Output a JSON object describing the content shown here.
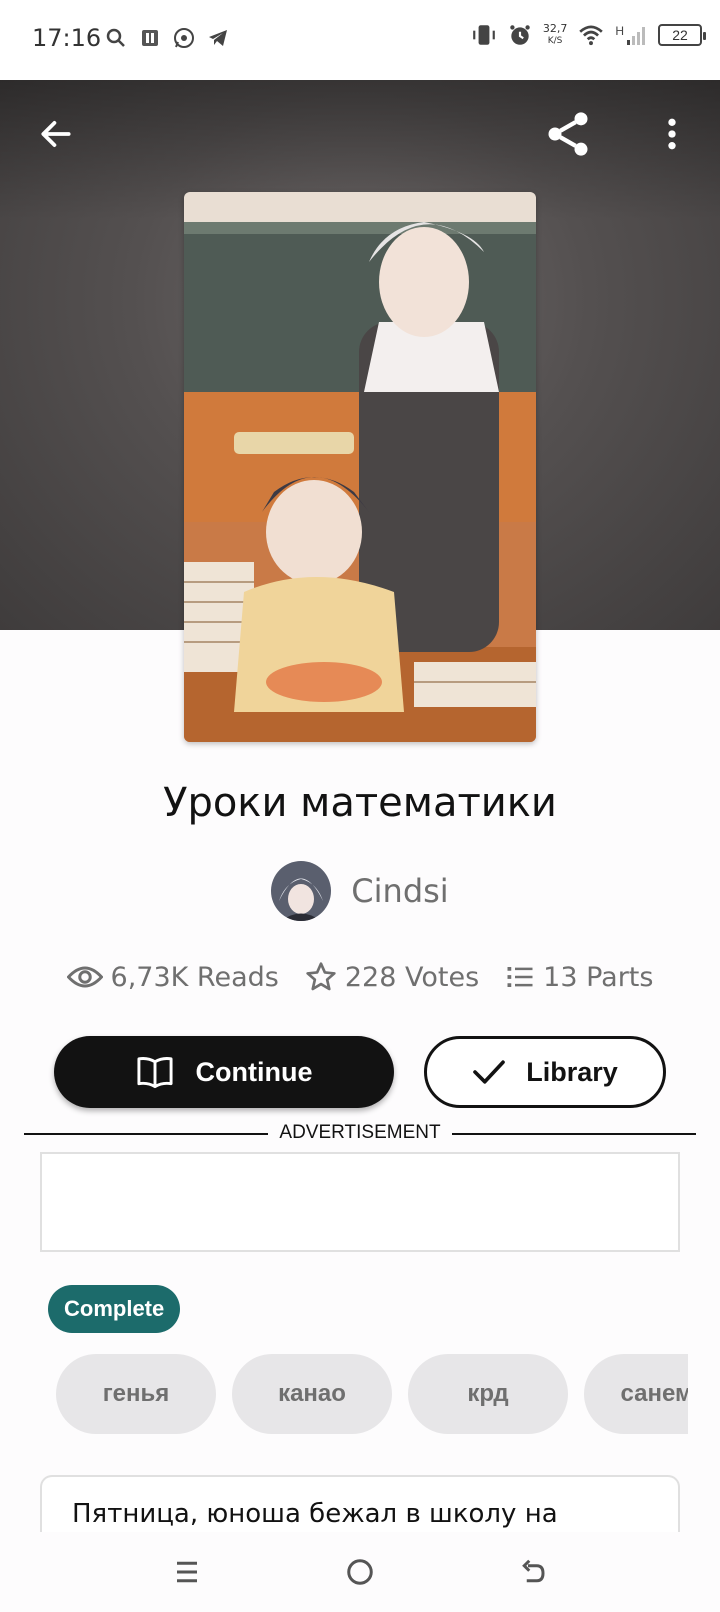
{
  "status_bar": {
    "time": "17:16",
    "net_speed_value": "32,7",
    "net_speed_unit": "K/S",
    "network_type": "H",
    "battery": "22"
  },
  "story": {
    "title": "Уроки математики",
    "author": "Cindsi",
    "reads": "6,73K Reads",
    "votes": "228 Votes",
    "parts": "13 Parts",
    "status_badge": "Complete",
    "description_preview": "Пятница, юноша бежал в школу на первый"
  },
  "actions": {
    "continue_label": "Continue",
    "library_label": "Library"
  },
  "ad": {
    "label": "ADVERTISEMENT"
  },
  "tags": [
    "генья",
    "канао",
    "крд",
    "санеми"
  ],
  "icons": {
    "back": "arrow-left-icon",
    "share": "share-icon",
    "more": "more-vertical-icon",
    "reads": "eye-icon",
    "votes": "star-icon",
    "parts": "list-icon",
    "continue": "open-book-icon",
    "library": "check-icon"
  },
  "colors": {
    "primary_button": "#121212",
    "complete_badge": "#1c6b6b",
    "tag_background": "#e7e6e8",
    "secondary_text": "#6f6f6f"
  }
}
